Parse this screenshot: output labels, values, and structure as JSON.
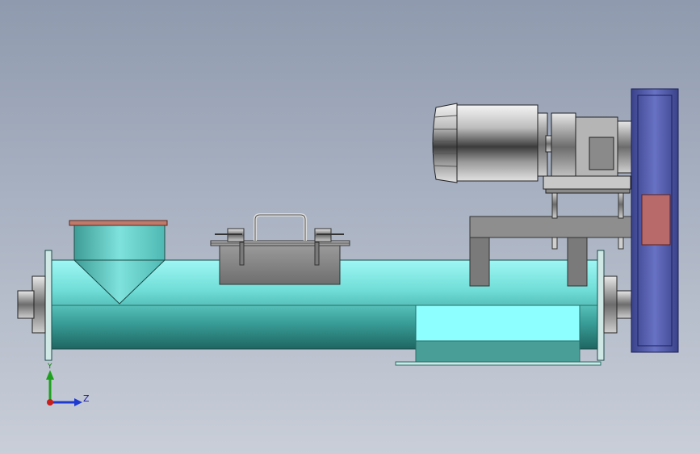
{
  "viewport": {
    "background_top": "#8f9aae",
    "background_bottom": "#c9ced8"
  },
  "colors": {
    "tube_light": "#8ff0ee",
    "tube_mid": "#4cc6c0",
    "tube_dark": "#1f6f6c",
    "tube_section": "#8effff",
    "tube_section_dark": "#4a9e98",
    "hopper_lid": "#c07a6a",
    "drive_plate": "#5e68b8",
    "drive_plate_dark": "#3a428a",
    "nameplate": "#b86a6a",
    "motor_light": "#e6e6e6",
    "motor_dark": "#3a3a3a",
    "frame_gray": "#8a8a8a",
    "frame_dark": "#555555"
  },
  "triad": {
    "z_label": "Z",
    "y_label": "Y",
    "x_color": "#c81e1e",
    "y_color": "#1ea01e",
    "z_color": "#1e3ad0"
  }
}
